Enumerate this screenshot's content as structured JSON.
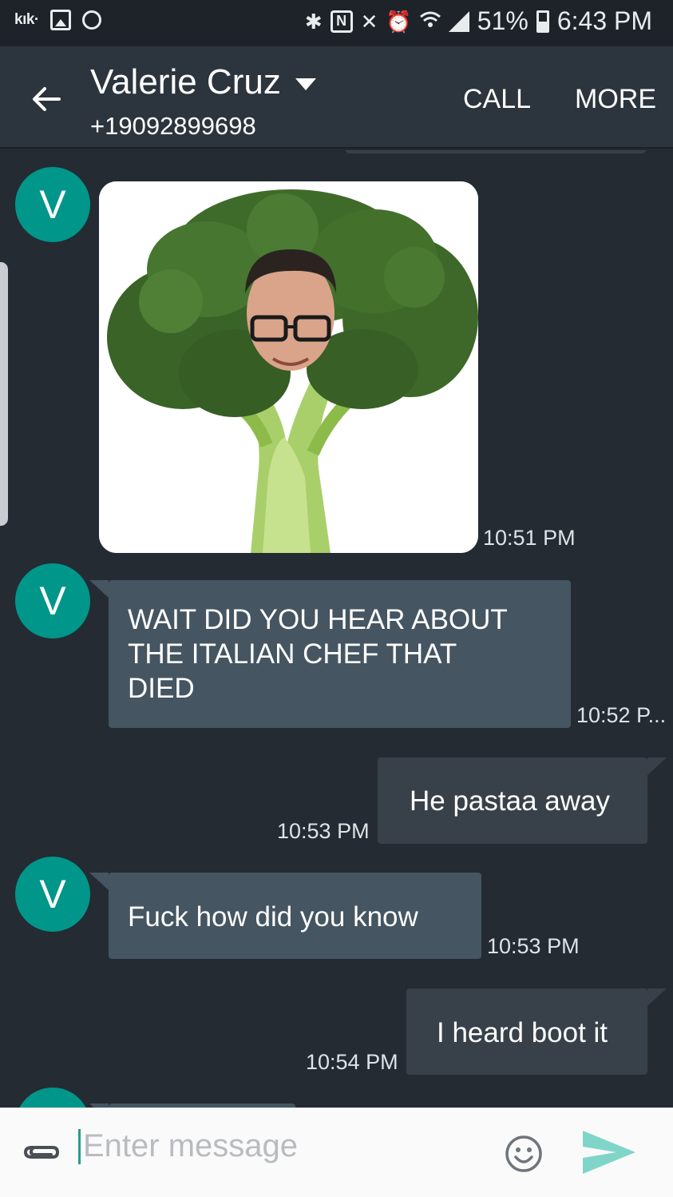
{
  "status_bar": {
    "app_label": "kık·",
    "nfc_label": "N",
    "battery": "51%",
    "time": "6:43 PM",
    "battery_level": 0.51
  },
  "header": {
    "contact_name": "Valerie Cruz",
    "phone": "+19092899698",
    "call_label": "CALL",
    "more_label": "MORE"
  },
  "messages": [
    {
      "direction": "incoming",
      "type": "image",
      "avatar_initial": "V",
      "image_desc_icon": "broccoli-photo",
      "time": "10:51 PM"
    },
    {
      "direction": "incoming",
      "type": "text",
      "avatar_initial": "V",
      "text": "WAIT DID YOU HEAR ABOUT THE ITALIAN CHEF THAT DIED",
      "time": "10:52 P..."
    },
    {
      "direction": "outgoing",
      "type": "text",
      "text": "He pastaa away",
      "time": "10:53 PM"
    },
    {
      "direction": "incoming",
      "type": "text",
      "avatar_initial": "V",
      "text": "Fuck how did you know",
      "time": "10:53 PM"
    },
    {
      "direction": "outgoing",
      "type": "text",
      "text": "I heard boot it",
      "time": "10:54 PM"
    }
  ],
  "composer": {
    "placeholder": "Enter message"
  },
  "colors": {
    "accent": "#00968a",
    "incoming_bubble": "#455561",
    "outgoing_bubble": "#38414a",
    "background": "#242b33"
  }
}
